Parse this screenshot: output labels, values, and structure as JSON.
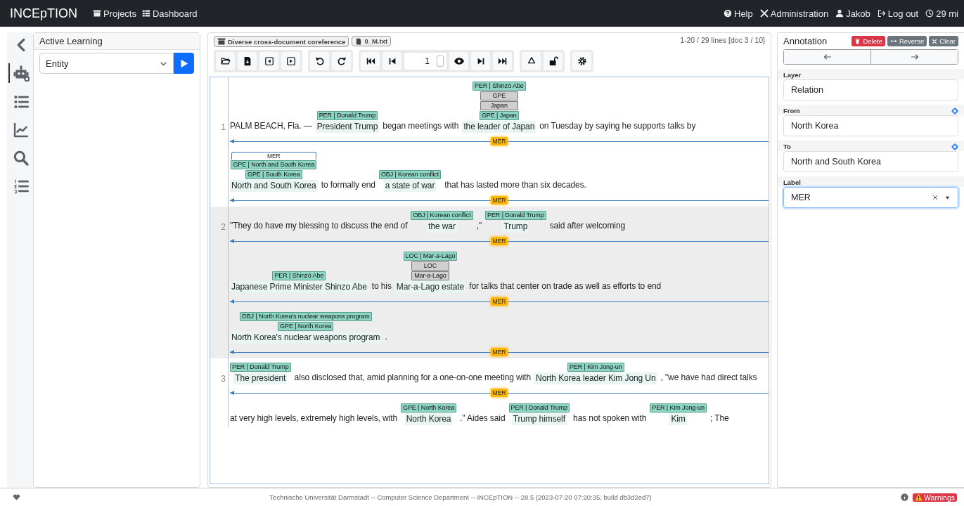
{
  "navbar": {
    "brand": "INCEpTION",
    "links": [
      {
        "kind": "projects",
        "label": "Projects"
      },
      {
        "kind": "dashboard",
        "label": "Dashboard"
      }
    ],
    "right_links": [
      {
        "kind": "help",
        "label": "Help"
      },
      {
        "kind": "admin",
        "label": "Administration"
      },
      {
        "kind": "user",
        "label": "Jakob"
      },
      {
        "kind": "logout",
        "label": "Log out"
      }
    ],
    "session": "29 mi"
  },
  "sidebar": {
    "items": [
      {
        "kind": "collapse",
        "selected": false
      },
      {
        "kind": "recommender",
        "selected": true
      },
      {
        "kind": "list",
        "selected": false
      },
      {
        "kind": "chart",
        "selected": false
      },
      {
        "kind": "search",
        "selected": false
      },
      {
        "kind": "ordered",
        "selected": false
      }
    ]
  },
  "active_learning": {
    "title": "Active Learning",
    "layer": "Entity"
  },
  "document": {
    "breadcrumbs": [
      {
        "kind": "project",
        "label": "Diverse cross-document coreference"
      },
      {
        "kind": "file",
        "label": "0_M.txt"
      }
    ],
    "position": "1-20 / 29 lines [doc 3 / 10]",
    "page": "1"
  },
  "sentences": [
    {
      "number": "1",
      "rows": [
        {
          "kind": "text",
          "items": [
            "PALM BEACH, Fla. —",
            {
              "text": "President Trump",
              "labels": [
                {
                  "kind": "entity",
                  "text": "PER | Donald Trump"
                }
              ]
            },
            "began meetings with",
            {
              "text": "the leader of Japan",
              "labels": [
                {
                  "kind": "entity",
                  "text": "PER | Shinzō Abe"
                },
                {
                  "kind": "feature",
                  "text": "GPE"
                },
                {
                  "kind": "feature",
                  "text": "Japan"
                },
                {
                  "kind": "entity",
                  "text": "GPE | Japan"
                }
              ]
            },
            "on Tuesday by saying he supports talks by"
          ]
        },
        {
          "kind": "arc",
          "label": "MER"
        },
        {
          "kind": "text",
          "items": [
            {
              "text": "North and South Korea",
              "labels": [
                {
                  "kind": "relation",
                  "text": "MER"
                },
                {
                  "kind": "entity",
                  "text": "GPE | North and South Korea"
                },
                {
                  "kind": "entity",
                  "text": "GPE | South Korea"
                }
              ]
            },
            "to formally end",
            {
              "text": "a state of war",
              "labels": [
                {
                  "kind": "entity",
                  "text": "OBJ | Korean conflict"
                }
              ]
            },
            "that has lasted more than six decades."
          ]
        },
        {
          "kind": "arc",
          "label": "MER"
        }
      ]
    },
    {
      "number": "2",
      "rows": [
        {
          "kind": "text",
          "items": [
            "\"They do have my blessing to discuss the end of",
            {
              "text": "the war",
              "labels": [
                {
                  "kind": "entity",
                  "text": "OBJ | Korean conflict"
                }
              ]
            },
            ",\"",
            {
              "text": "Trump",
              "labels": [
                {
                  "kind": "entity",
                  "text": "PER | Donald Trump"
                }
              ]
            },
            "said after welcoming"
          ]
        },
        {
          "kind": "arc",
          "label": "MER"
        },
        {
          "kind": "text",
          "items": [
            {
              "text": "Japanese Prime Minister Shinzo Abe",
              "labels": [
                {
                  "kind": "entity",
                  "text": "PER | Shinzō Abe"
                }
              ]
            },
            "to his",
            {
              "text": "Mar-a-Lago estate",
              "labels": [
                {
                  "kind": "entity",
                  "text": "LOC | Mar-a-Lago"
                },
                {
                  "kind": "feature",
                  "text": "LOC"
                },
                {
                  "kind": "feature",
                  "text": "Mar-a-Lago"
                }
              ]
            },
            "for talks that center on trade as well as efforts to end"
          ]
        },
        {
          "kind": "arc",
          "label": "MER"
        },
        {
          "kind": "text",
          "items": [
            {
              "text": "North Korea's nuclear weapons program",
              "labels": [
                {
                  "kind": "entity",
                  "text": "OBJ | North Korea's nuclear weapons program"
                },
                {
                  "kind": "entity",
                  "text": "GPE | North Korea"
                }
              ]
            },
            "."
          ]
        },
        {
          "kind": "arc",
          "label": "MER"
        }
      ]
    },
    {
      "number": "3",
      "rows": [
        {
          "kind": "text",
          "items": [
            {
              "text": "The president",
              "labels": [
                {
                  "kind": "entity",
                  "text": "PER | Donald Trump"
                }
              ]
            },
            "also disclosed that, amid planning for a one-on-one meeting with",
            {
              "text": "North Korea leader Kim Jong Un",
              "labels": [
                {
                  "kind": "entity",
                  "text": "PER | Kim Jong-un"
                }
              ]
            },
            ", \"we have had direct talks"
          ]
        },
        {
          "kind": "arc",
          "label": "MER"
        },
        {
          "kind": "text",
          "items": [
            "at very high levels, extremely high levels, with",
            {
              "text": "North Korea",
              "labels": [
                {
                  "kind": "entity",
                  "text": "GPE | North Korea"
                }
              ]
            },
            ".\" Aides said",
            {
              "text": "Trump himself",
              "labels": [
                {
                  "kind": "entity",
                  "text": "PER | Donald Trump"
                }
              ]
            },
            "has not spoken with",
            {
              "text": "Kim",
              "labels": [
                {
                  "kind": "entity",
                  "text": "PER | Kim Jong-un"
                }
              ]
            },
            "; The"
          ]
        }
      ]
    }
  ],
  "annotation": {
    "title": "Annotation",
    "buttons": [
      {
        "kind": "delete",
        "label": "Delete"
      },
      {
        "kind": "reverse",
        "label": "Reverse"
      },
      {
        "kind": "clear",
        "label": "Clear"
      }
    ],
    "fields": [
      {
        "label": "Layer",
        "value": "Relation",
        "kind": "text",
        "focused": false
      },
      {
        "label": "From",
        "value": "North Korea",
        "kind": "target",
        "focused": false
      },
      {
        "label": "To",
        "value": "North and South Korea",
        "kind": "target",
        "focused": false
      },
      {
        "label": "Label",
        "value": "MER",
        "kind": "combo",
        "focused": true
      }
    ]
  },
  "footer": {
    "text": "Technische Universität Darmstadt -- Computer Science Department -- INCEpTION -- 28.5 (2023-07-20 07:20:35, build db3d2ed7)",
    "warnings": "Warnings"
  }
}
